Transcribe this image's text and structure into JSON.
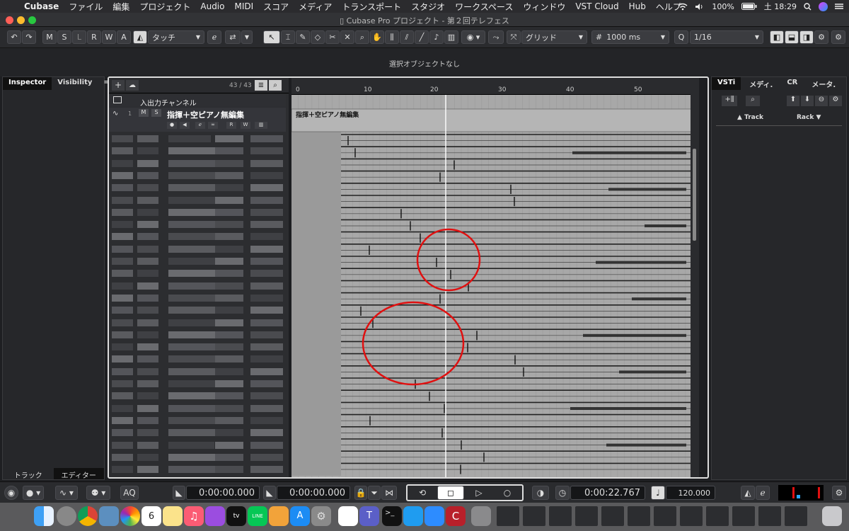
{
  "menubar": {
    "app": "Cubase",
    "items": [
      "ファイル",
      "編集",
      "プロジェクト",
      "Audio",
      "MIDI",
      "スコア",
      "メディア",
      "トランスポート",
      "スタジオ",
      "ワークスペース",
      "ウィンドウ",
      "VST Cloud",
      "Hub",
      "ヘルプ"
    ],
    "battery": "100%",
    "clock": "土 18:29"
  },
  "window": {
    "title": "Cubase Pro プロジェクト - 第２回テレフェス"
  },
  "toolbar": {
    "mute": "M",
    "solo": "S",
    "listen": "L",
    "read": "R",
    "write": "W",
    "auto": "A",
    "automation_mode": "タッチ",
    "snap_type": "グリッド",
    "grid_time": "1000 ms",
    "quantize_label": "Q",
    "quantize": "1/16"
  },
  "infoline": {
    "status": "選択オブジェクトなし"
  },
  "inspector": {
    "tab_inspector": "Inspector",
    "tab_visibility": "Visibility",
    "tab_menu": "=",
    "bottom_track": "トラック",
    "bottom_editor": "エディター"
  },
  "tracklist": {
    "count": "43 / 43",
    "folder_name": "入出力チャンネル",
    "track_number": "1",
    "track_name": "指揮＋空ピアノ無編集",
    "m": "M",
    "s": "S",
    "r": "R",
    "w": "W"
  },
  "arrange": {
    "ruler_ticks": [
      "0",
      "10",
      "20",
      "30",
      "40",
      "50"
    ],
    "event_name": "指揮＋空ピアノ無編集"
  },
  "rightpanel": {
    "tab_vsti": "VSTi",
    "tab_media": "メディ.",
    "tab_cr": "CR",
    "tab_meter": "メータ.",
    "track_label": "Track",
    "rack_label": "Rack"
  },
  "transport": {
    "left_locator": "0:00:00.000",
    "right_locator": "0:00:00.000",
    "position": "0:00:22.767",
    "tempo": "120.000",
    "aq": "AQ"
  },
  "colors": {
    "annotation": "#e01010",
    "waveform_bg": "#a8a8a8",
    "playhead": "#ffffff"
  }
}
